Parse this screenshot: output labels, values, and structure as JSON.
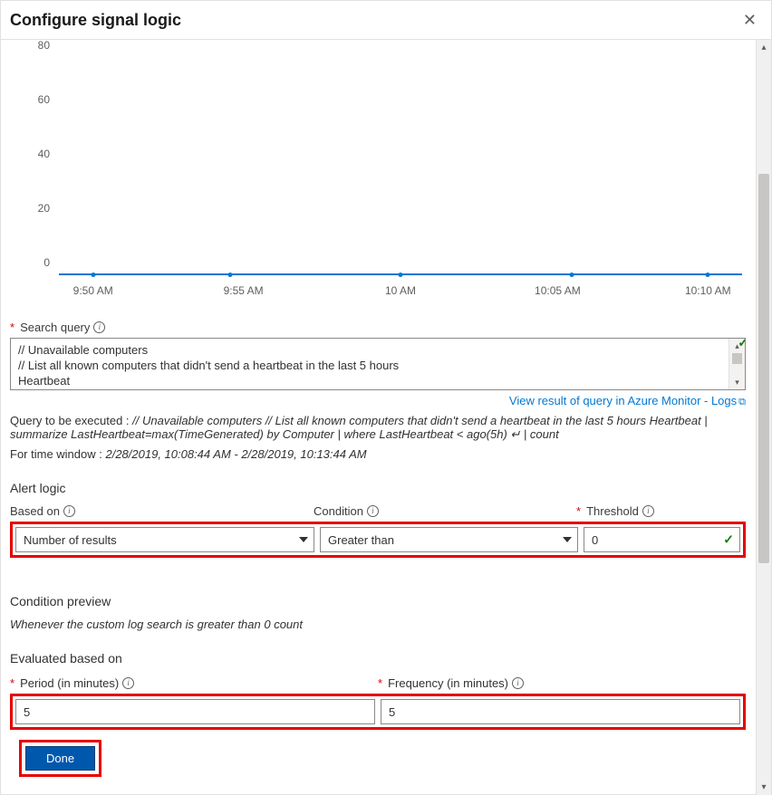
{
  "header": {
    "title": "Configure signal logic"
  },
  "chart_data": {
    "type": "line",
    "x": [
      "9:50 AM",
      "9:55 AM",
      "10 AM",
      "10:05 AM",
      "10:10 AM"
    ],
    "values": [
      0,
      0,
      0,
      0,
      0
    ],
    "ylim": [
      0,
      80
    ],
    "yticks": [
      0,
      20,
      40,
      60,
      80
    ],
    "xlabel": "",
    "ylabel": "",
    "title": ""
  },
  "search_query": {
    "label": "Search query",
    "lines": [
      "// Unavailable computers",
      "// List all known computers that didn't send a heartbeat in the last 5 hours",
      "Heartbeat"
    ]
  },
  "view_link": {
    "text": "View result of query in Azure Monitor - Logs"
  },
  "executed": {
    "prefix": "Query to be executed : ",
    "query_ital": "// Unavailable computers // List all known computers that didn't send a heartbeat in the last 5 hours Heartbeat | summarize LastHeartbeat=max(TimeGenerated) by Computer | where LastHeartbeat < ago(5h) ↵ | count",
    "time_window_prefix": "For time window : ",
    "time_window_value": "2/28/2019, 10:08:44 AM - 2/28/2019, 10:13:44 AM"
  },
  "alert_logic": {
    "section_title": "Alert logic",
    "based_on_label": "Based on",
    "based_on_value": "Number of results",
    "condition_label": "Condition",
    "condition_value": "Greater than",
    "threshold_label": "Threshold",
    "threshold_value": "0"
  },
  "condition_preview": {
    "title": "Condition preview",
    "text": "Whenever the custom log search is greater than 0 count"
  },
  "evaluated": {
    "title": "Evaluated based on",
    "period_label": "Period (in minutes)",
    "period_value": "5",
    "frequency_label": "Frequency (in minutes)",
    "frequency_value": "5"
  },
  "footer": {
    "done_label": "Done"
  }
}
